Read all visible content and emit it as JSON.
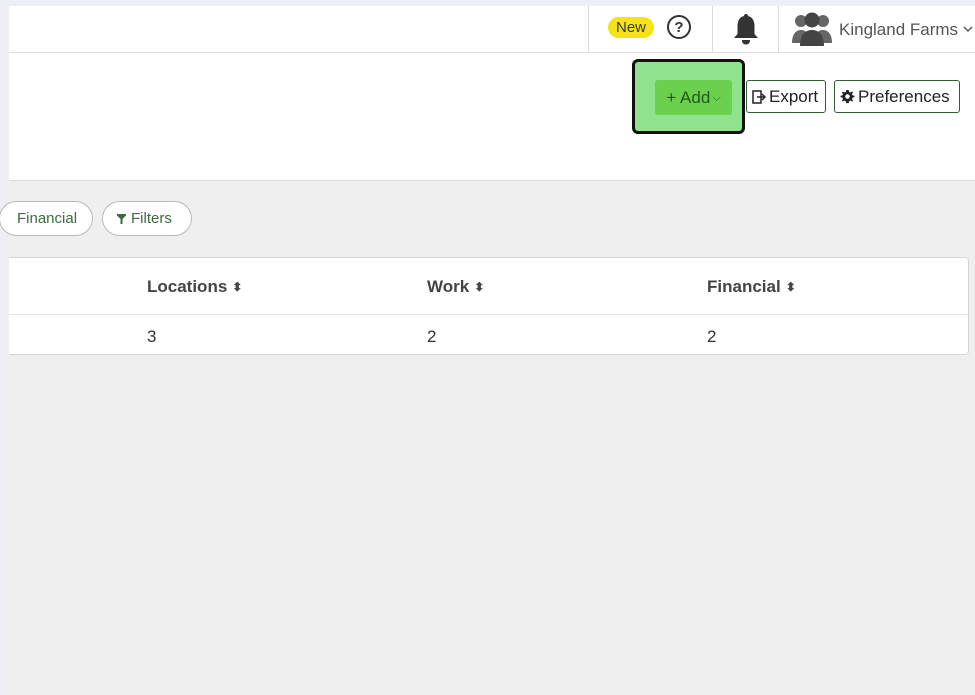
{
  "topbar": {
    "new_badge": "New",
    "help_icon_glyph": "?",
    "org_name": "Kingland Farms"
  },
  "toolbar": {
    "add_label": "+ Add",
    "add_chevron": "⌵",
    "export_label": "Export",
    "preferences_label": "Preferences"
  },
  "filters": {
    "financial_chip": "Financial",
    "filters_chip": "Filters"
  },
  "table": {
    "columns": [
      "Locations",
      "Work",
      "Financial"
    ],
    "sort_glyph": "⬍",
    "rows": [
      {
        "locations": "3",
        "work": "2",
        "financial": "2"
      }
    ]
  },
  "colors": {
    "accent_green": "#6cd04f",
    "highlight_green": "#8fe28e",
    "new_badge_yellow": "#f5e21a"
  },
  "icons": [
    "help-icon",
    "bell-icon",
    "users-icon",
    "chevron-down-icon",
    "export-icon",
    "gear-icon",
    "filter-icon",
    "sort-icon"
  ]
}
